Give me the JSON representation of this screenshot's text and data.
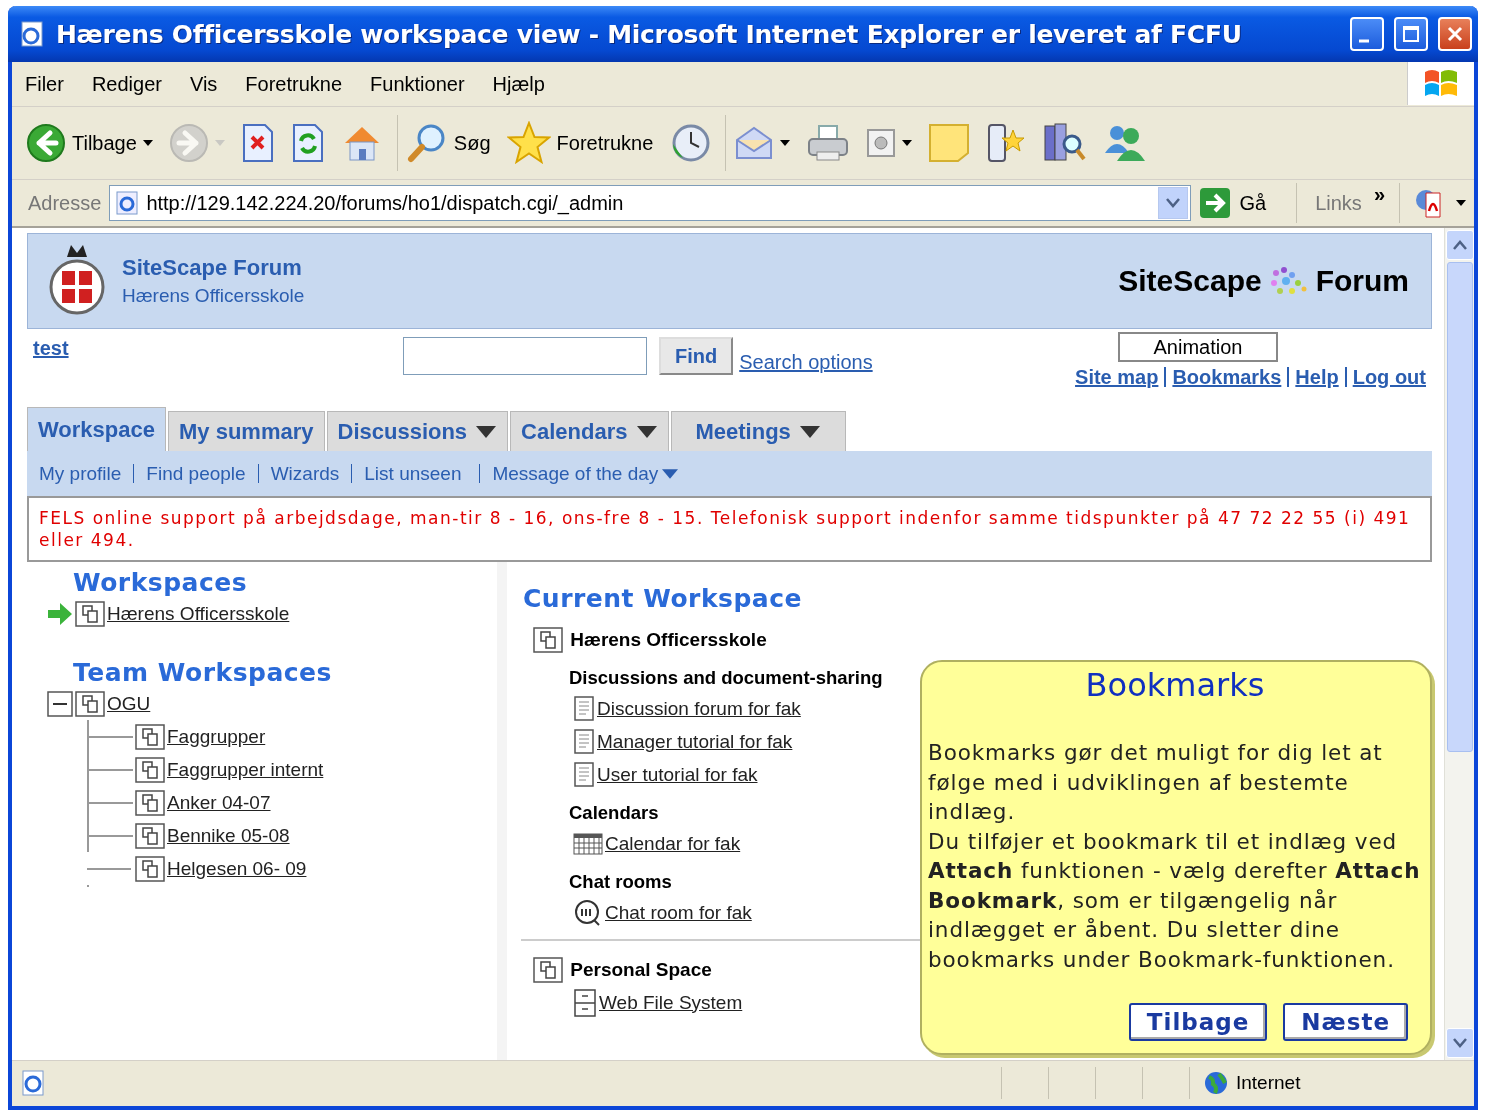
{
  "window": {
    "title": "Hærens Officersskole workspace view - Microsoft Internet Explorer er leveret af FCFU"
  },
  "menu": [
    "Filer",
    "Rediger",
    "Vis",
    "Foretrukne",
    "Funktioner",
    "Hjælp"
  ],
  "toolbar": [
    [
      {
        "kind": "back",
        "label": "Tilbage",
        "dropdown": true,
        "disabled": false
      },
      {
        "kind": "forward",
        "dropdown": true,
        "disabled": true
      },
      {
        "kind": "stop",
        "dropdown": false,
        "disabled": false
      },
      {
        "kind": "refresh",
        "dropdown": false,
        "disabled": false
      },
      {
        "kind": "home",
        "dropdown": false,
        "disabled": false
      }
    ],
    [
      {
        "kind": "search",
        "label": "Søg",
        "dropdown": false,
        "disabled": false
      },
      {
        "kind": "favorites",
        "label": "Foretrukne",
        "dropdown": false,
        "disabled": false
      },
      {
        "kind": "history",
        "dropdown": false,
        "disabled": false
      }
    ],
    [
      {
        "kind": "mail",
        "dropdown": true,
        "disabled": false
      },
      {
        "kind": "print",
        "dropdown": false,
        "disabled": false
      },
      {
        "kind": "media",
        "dropdown": true,
        "disabled": false
      },
      {
        "kind": "note",
        "dropdown": false,
        "disabled": false
      },
      {
        "kind": "phone",
        "dropdown": false,
        "disabled": false
      },
      {
        "kind": "research",
        "dropdown": false,
        "disabled": false
      },
      {
        "kind": "messenger",
        "dropdown": false,
        "disabled": false
      }
    ]
  ],
  "address": {
    "label": "Adresse",
    "value": "http://129.142.224.20/forums/ho1/dispatch.cgi/_admin",
    "go": "Gå",
    "links": "Links",
    "more": "»"
  },
  "site": {
    "name": "SiteScape Forum",
    "org": "Hærens Officersskole",
    "brand": "SiteScape",
    "brand_suffix": "Forum"
  },
  "topbar": {
    "user": "test",
    "find": "Find",
    "search_options": "Search options",
    "links": [
      "Site map",
      "Bookmarks",
      "Help",
      "Log out"
    ]
  },
  "animation_box": {
    "label": "Animation"
  },
  "tabs": [
    {
      "label": "Workspace",
      "selected": true,
      "menu": false
    },
    {
      "label": "My summary",
      "selected": false,
      "menu": false
    },
    {
      "label": "Discussions",
      "selected": false,
      "menu": true
    },
    {
      "label": "Calendars",
      "selected": false,
      "menu": true
    },
    {
      "label": "Meetings",
      "selected": false,
      "menu": true
    }
  ],
  "subnav": [
    {
      "label": "My profile",
      "menu": false
    },
    {
      "label": "Find people",
      "menu": false
    },
    {
      "label": "Wizards",
      "menu": false
    },
    {
      "label": "List unseen",
      "menu": false
    },
    {
      "label": "Message of the day",
      "menu": true
    }
  ],
  "notice": "FELS online support på arbejdsdage, man-tir 8 - 16, ons-fre 8 - 15. Telefonisk support indenfor samme tidspunkter på 47 72 22 55 (i) 491 eller 494.",
  "workspaces": {
    "title": "Workspaces",
    "items": [
      {
        "label": "Hærens Officersskole",
        "current": true
      }
    ]
  },
  "team": {
    "title": "Team Workspaces",
    "tree": [
      {
        "label": "OGU",
        "expanded": true,
        "children": [
          {
            "label": "Faggrupper"
          },
          {
            "label": "Faggrupper internt"
          },
          {
            "label": "Anker 04-07"
          },
          {
            "label": "Bennike 05-08"
          },
          {
            "label": "Helgesen 06- 09"
          }
        ]
      }
    ]
  },
  "current": {
    "title": "Current Workspace",
    "workspace": "Hærens Officersskole",
    "sections": [
      {
        "title": "Discussions and document-sharing",
        "items": [
          {
            "kind": "forum",
            "label": "Discussion forum for fak"
          },
          {
            "kind": "forum",
            "label": "Manager tutorial for fak"
          },
          {
            "kind": "forum",
            "label": "User tutorial for fak"
          }
        ]
      },
      {
        "title": "Calendars",
        "items": [
          {
            "kind": "calendar",
            "label": "Calendar for fak"
          }
        ]
      },
      {
        "title": "Chat rooms",
        "items": [
          {
            "kind": "chat",
            "label": "Chat room for fak"
          }
        ]
      }
    ],
    "personal": {
      "title": "Personal Space",
      "items": [
        {
          "kind": "files",
          "label": "Web File System"
        }
      ]
    }
  },
  "tooltip": {
    "title": "Bookmarks",
    "paragraphs": [
      "Bookmarks gør det muligt for dig let at følge med i udviklingen af bestemte indlæg.",
      "Du tilføjer et bookmark til et indlæg ved **Attach** funktionen - vælg derefter **Attach Bookmark**, som er tilgængelig når indlægget er åbent. Du sletter dine bookmarks under Bookmark-funktionen."
    ],
    "buttons": [
      "Tilbage",
      "Næste"
    ]
  },
  "status": {
    "zone": "Internet"
  }
}
